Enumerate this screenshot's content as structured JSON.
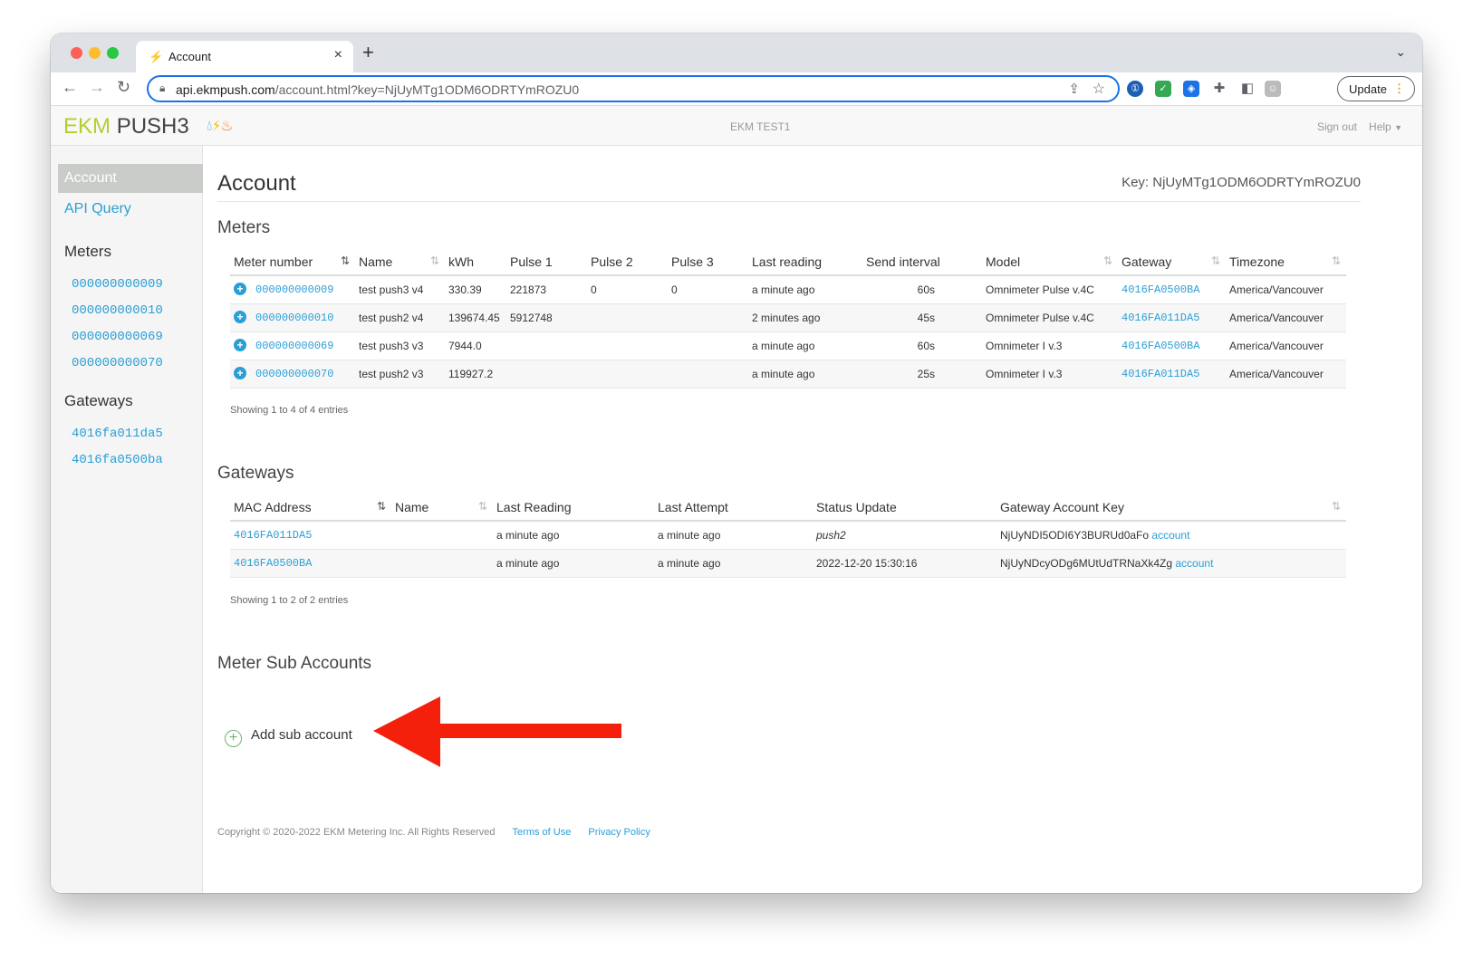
{
  "browser": {
    "tab_title": "Account",
    "url_host": "api.ekmpush.com",
    "url_path": "/account.html?key=NjUyMTg1ODM6ODRTYmROZU0",
    "update_label": "Update"
  },
  "header": {
    "brand_ekm": "EKM",
    "brand_push": "PUSH3",
    "account_name": "EKM TEST1",
    "sign_out": "Sign out",
    "help": "Help"
  },
  "sidebar": {
    "active": "Account",
    "api_query": "API Query",
    "meters_heading": "Meters",
    "meters": [
      "000000000009",
      "000000000010",
      "000000000069",
      "000000000070"
    ],
    "gateways_heading": "Gateways",
    "gateways": [
      "4016fa011da5",
      "4016fa0500ba"
    ]
  },
  "page": {
    "title": "Account",
    "key_label": "Key: NjUyMTg1ODM6ODRTYmROZU0"
  },
  "meters_section": {
    "title": "Meters",
    "columns": [
      "Meter number",
      "Name",
      "kWh",
      "Pulse 1",
      "Pulse 2",
      "Pulse 3",
      "Last reading",
      "Send interval",
      "Model",
      "Gateway",
      "Timezone"
    ],
    "rows": [
      {
        "meter": "000000000009",
        "name": "test push3 v4",
        "kwh": "330.39",
        "p1": "221873",
        "p2": "0",
        "p3": "0",
        "last": "a minute ago",
        "interval": "60s",
        "model": "Omnimeter Pulse v.4C",
        "gateway": "4016FA0500BA",
        "tz": "America/Vancouver"
      },
      {
        "meter": "000000000010",
        "name": "test push2 v4",
        "kwh": "139674.45",
        "p1": "5912748",
        "p2": "",
        "p3": "",
        "last": "2 minutes ago",
        "interval": "45s",
        "model": "Omnimeter Pulse v.4C",
        "gateway": "4016FA011DA5",
        "tz": "America/Vancouver"
      },
      {
        "meter": "000000000069",
        "name": "test push3 v3",
        "kwh": "7944.0",
        "p1": "",
        "p2": "",
        "p3": "",
        "last": "a minute ago",
        "interval": "60s",
        "model": "Omnimeter I v.3",
        "gateway": "4016FA0500BA",
        "tz": "America/Vancouver"
      },
      {
        "meter": "000000000070",
        "name": "test push2 v3",
        "kwh": "119927.2",
        "p1": "",
        "p2": "",
        "p3": "",
        "last": "a minute ago",
        "interval": "25s",
        "model": "Omnimeter I v.3",
        "gateway": "4016FA011DA5",
        "tz": "America/Vancouver"
      }
    ],
    "showing": "Showing 1 to 4 of 4 entries"
  },
  "gateways_section": {
    "title": "Gateways",
    "columns": [
      "MAC Address",
      "Name",
      "Last Reading",
      "Last Attempt",
      "Status Update",
      "Gateway Account Key"
    ],
    "rows": [
      {
        "mac": "4016FA011DA5",
        "name": "",
        "last_reading": "a minute ago",
        "last_attempt": "a minute ago",
        "status": "push2",
        "key": "NjUyNDI5ODI6Y3BURUd0aFo",
        "key_link": "account"
      },
      {
        "mac": "4016FA0500BA",
        "name": "",
        "last_reading": "a minute ago",
        "last_attempt": "a minute ago",
        "status": "2022-12-20 15:30:16",
        "key": "NjUyNDcyODg6MUtUdTRNaXk4Zg",
        "key_link": "account"
      }
    ],
    "showing": "Showing 1 to 2 of 2 entries"
  },
  "sub_accounts": {
    "title": "Meter Sub Accounts",
    "add_label": "Add sub account"
  },
  "footer": {
    "copyright": "Copyright © 2020-2022 EKM Metering Inc. All Rights Reserved",
    "terms": "Terms of Use",
    "privacy": "Privacy Policy"
  },
  "colors": {
    "link": "#2a9fd6",
    "brand_green": "#b5cd2e",
    "annotation_arrow": "#f4200c"
  }
}
